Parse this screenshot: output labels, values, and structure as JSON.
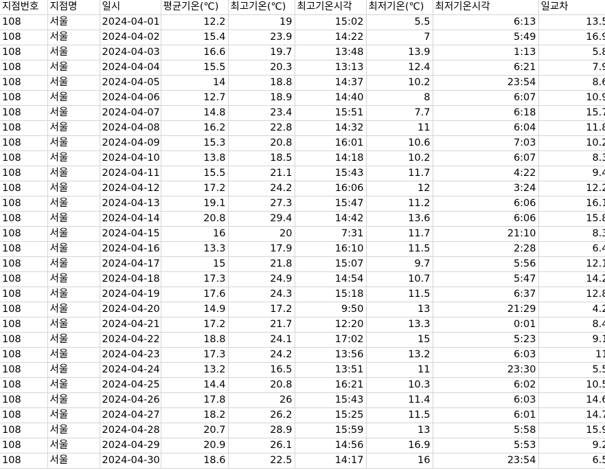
{
  "columns": [
    "지점번호",
    "지점명",
    "일시",
    "평균기온(℃)",
    "최고기온(℃)",
    "최고기온시각",
    "최저기온(℃)",
    "최저기온시각",
    "일교차"
  ],
  "rows": [
    [
      "108",
      "서울",
      "2024-04-01",
      "12.2",
      "19",
      "15:02",
      "5.5",
      "6:13",
      "13.5"
    ],
    [
      "108",
      "서울",
      "2024-04-02",
      "15.4",
      "23.9",
      "14:22",
      "7",
      "5:49",
      "16.9"
    ],
    [
      "108",
      "서울",
      "2024-04-03",
      "16.6",
      "19.7",
      "13:48",
      "13.9",
      "1:13",
      "5.8"
    ],
    [
      "108",
      "서울",
      "2024-04-04",
      "15.5",
      "20.3",
      "13:13",
      "12.4",
      "6:21",
      "7.9"
    ],
    [
      "108",
      "서울",
      "2024-04-05",
      "14",
      "18.8",
      "14:37",
      "10.2",
      "23:54",
      "8.6"
    ],
    [
      "108",
      "서울",
      "2024-04-06",
      "12.7",
      "18.9",
      "14:40",
      "8",
      "6:07",
      "10.9"
    ],
    [
      "108",
      "서울",
      "2024-04-07",
      "14.8",
      "23.4",
      "15:51",
      "7.7",
      "6:18",
      "15.7"
    ],
    [
      "108",
      "서울",
      "2024-04-08",
      "16.2",
      "22.8",
      "14:32",
      "11",
      "6:04",
      "11.8"
    ],
    [
      "108",
      "서울",
      "2024-04-09",
      "15.3",
      "20.8",
      "16:01",
      "10.6",
      "7:03",
      "10.2"
    ],
    [
      "108",
      "서울",
      "2024-04-10",
      "13.8",
      "18.5",
      "14:18",
      "10.2",
      "6:07",
      "8.3"
    ],
    [
      "108",
      "서울",
      "2024-04-11",
      "15.5",
      "21.1",
      "15:43",
      "11.7",
      "4:22",
      "9.4"
    ],
    [
      "108",
      "서울",
      "2024-04-12",
      "17.2",
      "24.2",
      "16:06",
      "12",
      "3:24",
      "12.2"
    ],
    [
      "108",
      "서울",
      "2024-04-13",
      "19.1",
      "27.3",
      "15:47",
      "11.2",
      "6:06",
      "16.1"
    ],
    [
      "108",
      "서울",
      "2024-04-14",
      "20.8",
      "29.4",
      "14:42",
      "13.6",
      "6:06",
      "15.8"
    ],
    [
      "108",
      "서울",
      "2024-04-15",
      "16",
      "20",
      "7:31",
      "11.7",
      "21:10",
      "8.3"
    ],
    [
      "108",
      "서울",
      "2024-04-16",
      "13.3",
      "17.9",
      "16:10",
      "11.5",
      "2:28",
      "6.4"
    ],
    [
      "108",
      "서울",
      "2024-04-17",
      "15",
      "21.8",
      "15:07",
      "9.7",
      "5:56",
      "12.1"
    ],
    [
      "108",
      "서울",
      "2024-04-18",
      "17.3",
      "24.9",
      "14:54",
      "10.7",
      "5:47",
      "14.2"
    ],
    [
      "108",
      "서울",
      "2024-04-19",
      "17.6",
      "24.3",
      "15:18",
      "11.5",
      "6:37",
      "12.8"
    ],
    [
      "108",
      "서울",
      "2024-04-20",
      "14.9",
      "17.2",
      "9:50",
      "13",
      "21:29",
      "4.2"
    ],
    [
      "108",
      "서울",
      "2024-04-21",
      "17.2",
      "21.7",
      "12:20",
      "13.3",
      "0:01",
      "8.4"
    ],
    [
      "108",
      "서울",
      "2024-04-22",
      "18.8",
      "24.1",
      "17:02",
      "15",
      "5:23",
      "9.1"
    ],
    [
      "108",
      "서울",
      "2024-04-23",
      "17.3",
      "24.2",
      "13:56",
      "13.2",
      "6:03",
      "11"
    ],
    [
      "108",
      "서울",
      "2024-04-24",
      "13.2",
      "16.5",
      "13:51",
      "11",
      "23:30",
      "5.5"
    ],
    [
      "108",
      "서울",
      "2024-04-25",
      "14.4",
      "20.8",
      "16:21",
      "10.3",
      "6:02",
      "10.5"
    ],
    [
      "108",
      "서울",
      "2024-04-26",
      "17.8",
      "26",
      "15:43",
      "11.4",
      "6:03",
      "14.6"
    ],
    [
      "108",
      "서울",
      "2024-04-27",
      "18.2",
      "26.2",
      "15:25",
      "11.5",
      "6:01",
      "14.7"
    ],
    [
      "108",
      "서울",
      "2024-04-28",
      "20.7",
      "28.9",
      "15:59",
      "13",
      "5:58",
      "15.9"
    ],
    [
      "108",
      "서울",
      "2024-04-29",
      "20.9",
      "26.1",
      "14:56",
      "16.9",
      "5:53",
      "9.2"
    ],
    [
      "108",
      "서울",
      "2024-04-30",
      "18.6",
      "22.5",
      "14:17",
      "16",
      "23:54",
      "6.5"
    ]
  ]
}
